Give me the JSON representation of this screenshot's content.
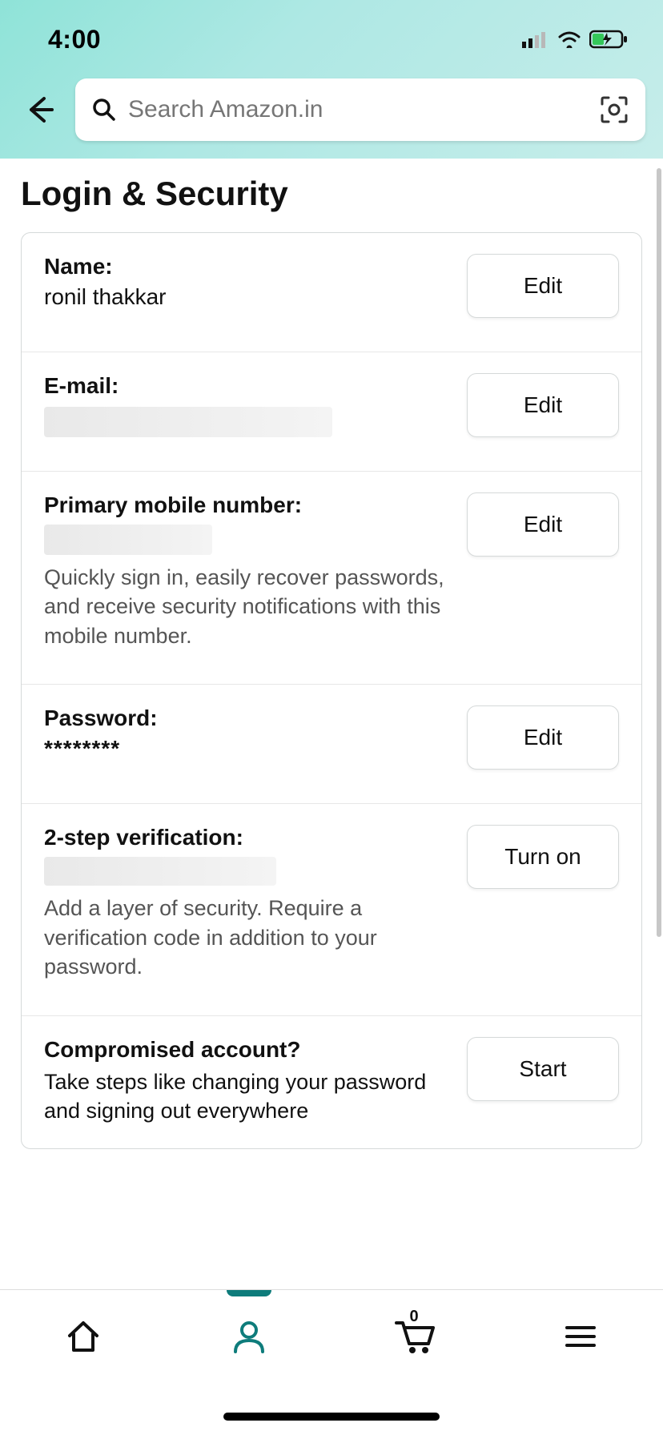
{
  "status": {
    "time": "4:00"
  },
  "search": {
    "placeholder": "Search Amazon.in"
  },
  "page": {
    "title": "Login & Security"
  },
  "rows": {
    "name": {
      "label": "Name:",
      "value": "ronil thakkar",
      "button": "Edit"
    },
    "email": {
      "label": "E-mail:",
      "button": "Edit"
    },
    "phone": {
      "label": "Primary mobile number:",
      "desc": "Quickly sign in, easily recover passwords, and receive security notifications with this mobile number.",
      "button": "Edit"
    },
    "password": {
      "label": "Password:",
      "value": "********",
      "button": "Edit"
    },
    "twostep": {
      "label": "2-step verification:",
      "desc": "Add a layer of security. Require a verification code in addition to your password.",
      "button": "Turn on"
    },
    "compromised": {
      "label": "Compromised account?",
      "desc": "Take steps like changing your password and signing out everywhere",
      "button": "Start"
    }
  },
  "nav": {
    "cart_count": "0"
  }
}
